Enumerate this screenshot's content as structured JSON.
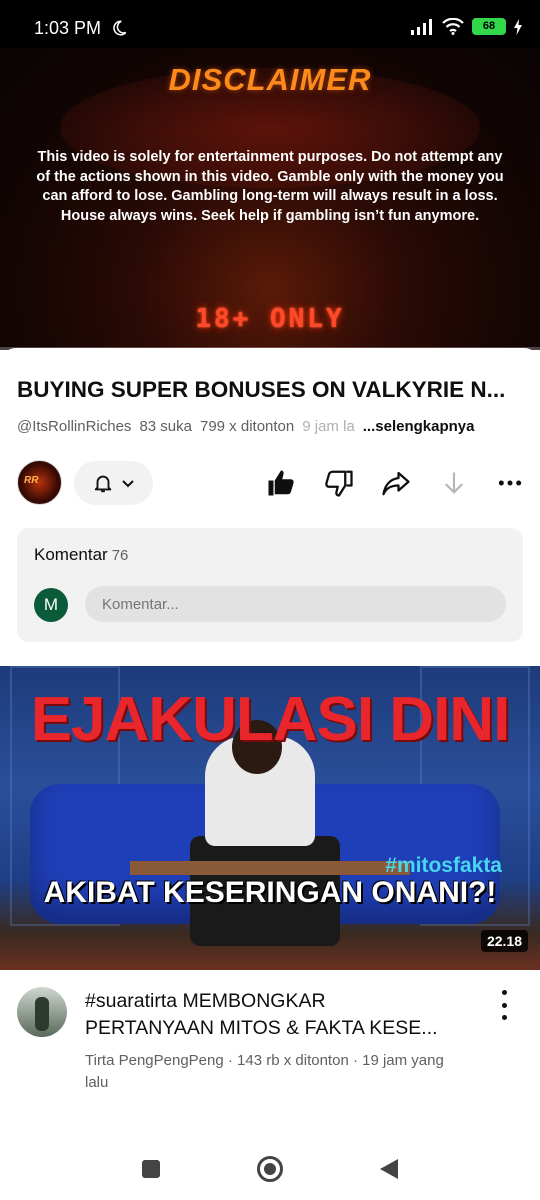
{
  "status": {
    "time": "1:03 PM",
    "battery": "68"
  },
  "player": {
    "disclaimer_title": "DISCLAIMER",
    "disclaimer_text": "This video is solely for entertainment purposes. Do not attempt any of the actions shown in this video. Gamble only with the money you can afford to lose. Gambling long-term will always result in a loss. House always wins. Seek help if gambling isn’t fun anymore.",
    "age_tag": "18+ ONLY"
  },
  "video": {
    "title": "BUYING SUPER BONUSES ON VALKYRIE N...",
    "channel": "@ItsRollinRiches",
    "likes": "83 suka",
    "views": "799 x ditonton",
    "age": "9 jam la",
    "more_label": "...selengkapnya"
  },
  "comments": {
    "label": "Komentar",
    "count": "76",
    "user_initial": "M",
    "placeholder": "Komentar..."
  },
  "next_video": {
    "thumb_title": "EJAKULASI DINI",
    "thumb_hashtag": "#mitosfakta",
    "thumb_subtitle": "AKIBAT KESERINGAN ONANI?!",
    "duration": "22.18",
    "title_line1": "#suaratirta MEMBONGKAR",
    "title_line2": "PERTANYAAN MITOS & FAKTA KESE...",
    "meta_line1": "Tirta PengPengPeng · 143 rb x ditonton · 19 jam yang",
    "meta_line2": "lalu"
  },
  "colors": {
    "accent_orange": "#ff8a1c",
    "thumb_red": "#e8262b",
    "hashtag_cyan": "#46d7f0",
    "user_avatar": "#0b5a3a"
  }
}
